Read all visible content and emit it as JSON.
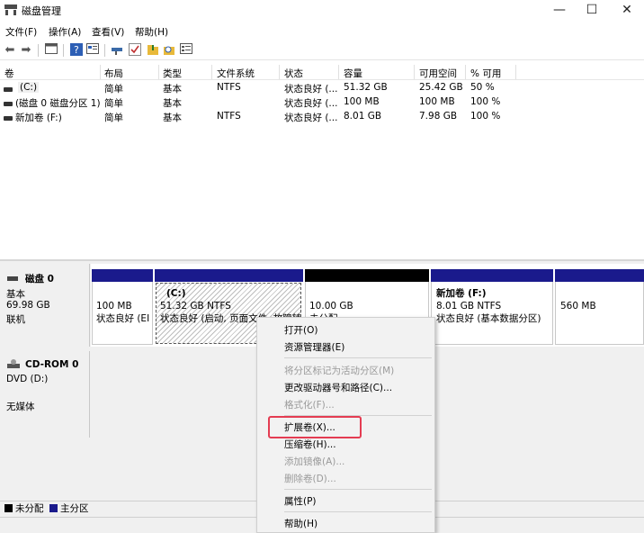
{
  "window": {
    "title": "磁盘管理",
    "minimize": "—",
    "maximize": "☐",
    "close": "✕"
  },
  "menu": [
    "文件(F)",
    "操作(A)",
    "查看(V)",
    "帮助(H)"
  ],
  "toolbar": {
    "icons": [
      "back-icon",
      "forward-icon",
      "console-tree-icon",
      "help-icon",
      "properties-icon",
      "connect-icon",
      "check-icon",
      "folder-icon",
      "search-icon",
      "settings-icon"
    ]
  },
  "table": {
    "headers": [
      "卷",
      "布局",
      "类型",
      "文件系统",
      "状态",
      "容量",
      "可用空间",
      "% 可用"
    ],
    "rows": [
      [
        "(C:)",
        "简单",
        "基本",
        "NTFS",
        "状态良好 (...",
        "51.32 GB",
        "25.42 GB",
        "50 %"
      ],
      [
        "(磁盘 0 磁盘分区 1)",
        "简单",
        "基本",
        "",
        "状态良好 (...",
        "100 MB",
        "100 MB",
        "100 %"
      ],
      [
        "新加卷 (F:)",
        "简单",
        "基本",
        "NTFS",
        "状态良好 (...",
        "8.01 GB",
        "7.98 GB",
        "100 %"
      ]
    ]
  },
  "disk0": {
    "name": "磁盘 0",
    "type": "基本",
    "size": "69.98 GB",
    "status": "联机",
    "partitions": [
      {
        "title": "",
        "line1": "100 MB",
        "line2": "状态良好 (EI"
      },
      {
        "title": "(C:)",
        "line1": "51.32 GB NTFS",
        "line2": "状态良好 (启动, 页面文件, 故障转"
      },
      {
        "title": "",
        "line1": "10.00 GB",
        "line2": "未分配"
      },
      {
        "title": "新加卷 (F:)",
        "line1": "8.01 GB NTFS",
        "line2": "状态良好 (基本数据分区)"
      },
      {
        "title": "",
        "line1": "560 MB",
        "line2": ""
      }
    ]
  },
  "cdrom": {
    "name": "CD-ROM 0",
    "drive": "DVD (D:)",
    "media": "无媒体"
  },
  "legend": {
    "unallocated": "未分配",
    "primary": "主分区",
    "colors": {
      "unallocated": "#000000",
      "primary": "#1a1a8c"
    }
  },
  "context_menu": {
    "open": "打开(O)",
    "explorer": "资源管理器(E)",
    "mark_active": "将分区标记为活动分区(M)",
    "change_letter": "更改驱动器号和路径(C)...",
    "format": "格式化(F)...",
    "extend": "扩展卷(X)...",
    "shrink": "压缩卷(H)...",
    "add_mirror": "添加镜像(A)...",
    "delete": "删除卷(D)...",
    "properties": "属性(P)",
    "help": "帮助(H)"
  },
  "colors": {
    "highlight": "#e43c52",
    "primary_strip": "#1a1a8c"
  }
}
